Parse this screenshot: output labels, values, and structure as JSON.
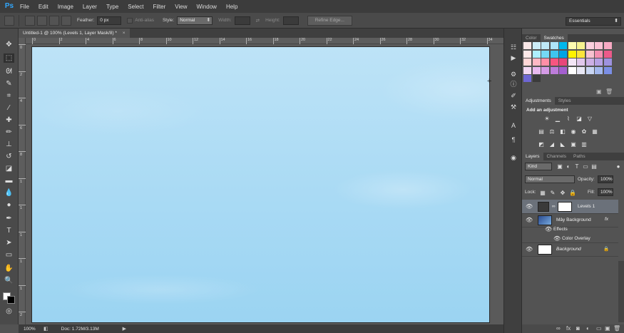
{
  "app": {
    "logo": "Ps"
  },
  "menu": [
    "File",
    "Edit",
    "Image",
    "Layer",
    "Type",
    "Select",
    "Filter",
    "View",
    "Window",
    "Help"
  ],
  "options": {
    "feather_label": "Feather:",
    "feather_value": "0 px",
    "antialias_label": "Anti-alias",
    "style_label": "Style:",
    "style_value": "Normal",
    "width_label": "Width:",
    "height_label": "Height:",
    "refine_edge": "Refine Edge...",
    "workspace": "Essentials"
  },
  "document": {
    "tab_title": "Untitled-1 @ 100% (Levels 1, Layer Mask/8) *",
    "close_glyph": "×",
    "ruler_numbers": [
      "0",
      "2",
      "4",
      "6",
      "8",
      "10",
      "12",
      "14",
      "16",
      "18",
      "20",
      "22",
      "24",
      "26",
      "28",
      "30",
      "32",
      "34"
    ],
    "ruler_left_numbers": [
      "0",
      "2",
      "4",
      "6",
      "8",
      "1",
      "1",
      "1",
      "1",
      "1",
      "2",
      "2"
    ]
  },
  "status": {
    "zoom": "100%",
    "doc_info": "Doc: 1.72M/3.13M"
  },
  "panels": {
    "color_tabs": [
      "Color",
      "Swatches"
    ],
    "adjust_tabs": [
      "Adjustments",
      "Styles"
    ],
    "adjust_title": "Add an adjustment",
    "layers_tabs": [
      "Layers",
      "Channels",
      "Paths"
    ],
    "kind": "Kind",
    "blend_mode": "Normal",
    "opacity_label": "Opacity:",
    "opacity_value": "100%",
    "lock_label": "Lock:",
    "fill_label": "Fill:",
    "fill_value": "100%"
  },
  "layers": [
    {
      "name": "Levels 1",
      "selected": true
    },
    {
      "name": "Mây Background",
      "fx": "fx"
    },
    {
      "name": "Effects"
    },
    {
      "name": "Color Overlay"
    },
    {
      "name": "Background"
    }
  ],
  "swatch_colors": [
    [
      "#f7e6e6",
      "#ccecf7",
      "#bfe9f7",
      "#aee4f8",
      "#00b7ec",
      "#fdfbb0",
      "#f6f28f",
      "#fbd0de",
      "#fac1d4",
      "#f7a9c3"
    ],
    [
      "#fde8e8",
      "#aeefff",
      "#74d9f5",
      "#3fc6ef",
      "#00a4e4",
      "#fff200",
      "#fbe43a",
      "#f7c1d0",
      "#f48fb1",
      "#ec5a8a"
    ],
    [
      "#ffd6d6",
      "#ffb8c4",
      "#ff8fa6",
      "#f75580",
      "#e8467a",
      "#f3e6f6",
      "#e1c8ec",
      "#cdb0e6",
      "#b6a1e4",
      "#9e92df"
    ],
    [
      "#f2d7f2",
      "#e8b9ef",
      "#d59be6",
      "#bd7ddb",
      "#a45fcf",
      "#ffffff",
      "#e8e8f5",
      "#c9d6f3",
      "#a3b8ee",
      "#7b8fe6"
    ],
    [
      "#6e66d4",
      "#3b3b3b"
    ]
  ]
}
